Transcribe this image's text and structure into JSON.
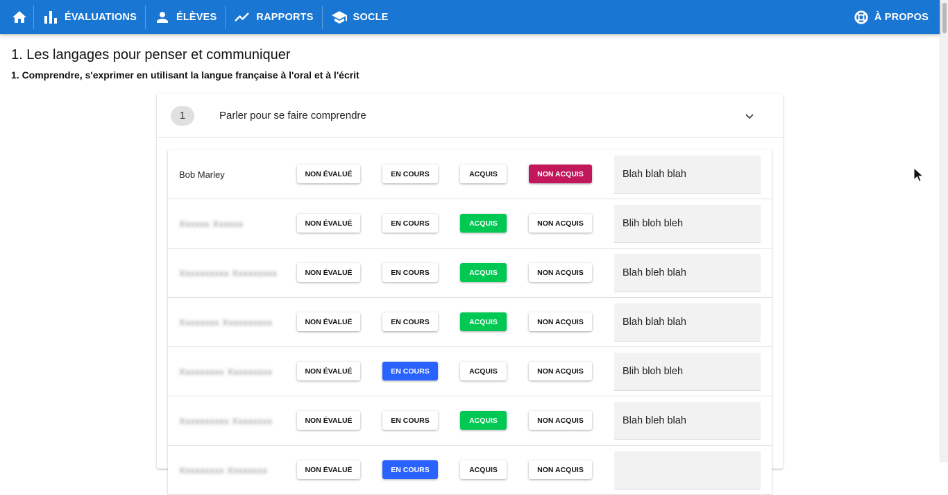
{
  "nav": {
    "home_icon": "home-icon",
    "items": [
      {
        "label": "Évaluations",
        "icon": "bar-chart-icon"
      },
      {
        "label": "Élèves",
        "icon": "person-icon"
      },
      {
        "label": "Rapports",
        "icon": "trending-up-icon"
      },
      {
        "label": "Socle",
        "icon": "school-icon"
      }
    ],
    "about": {
      "label": "À propos",
      "icon": "lifebuoy-icon"
    }
  },
  "page": {
    "title": "1. Les langages pour penser et communiquer",
    "subtitle": "1. Comprendre, s'exprimer en utilisant la langue française à l'oral et à l'écrit"
  },
  "panel": {
    "number": "1",
    "title": "Parler pour se faire comprendre",
    "toggle_icon": "chevron-down-icon"
  },
  "options": {
    "non_evalue": "Non évalué",
    "en_cours": "En cours",
    "acquis": "Acquis",
    "non_acquis": "Non acquis"
  },
  "students": [
    {
      "name": "Bob Marley",
      "blurred": false,
      "status": "non_acquis",
      "comment": "Blah blah blah"
    },
    {
      "name": "Xxxxxx Xxxxxx",
      "blurred": true,
      "status": "acquis",
      "comment": "Blih bloh bleh"
    },
    {
      "name": "Xxxxxxxxxx Xxxxxxxxx",
      "blurred": true,
      "status": "acquis",
      "comment": "Blah bleh blah"
    },
    {
      "name": "Xxxxxxxx Xxxxxxxxxx",
      "blurred": true,
      "status": "acquis",
      "comment": "Blah blah blah"
    },
    {
      "name": "Xxxxxxxxx Xxxxxxxxx",
      "blurred": true,
      "status": "en_cours",
      "comment": "Blih bloh bleh"
    },
    {
      "name": "Xxxxxxxxxx Xxxxxxxx",
      "blurred": true,
      "status": "acquis",
      "comment": "Blah bleh blah"
    },
    {
      "name": "Xxxxxxxxx Xxxxxxxx",
      "blurred": true,
      "status": "en_cours",
      "comment": ""
    }
  ],
  "colors": {
    "appbar": "#1976d2",
    "non_acquis_active": "#c2185b",
    "acquis_active": "#00c853",
    "en_cours_active": "#2962ff"
  }
}
